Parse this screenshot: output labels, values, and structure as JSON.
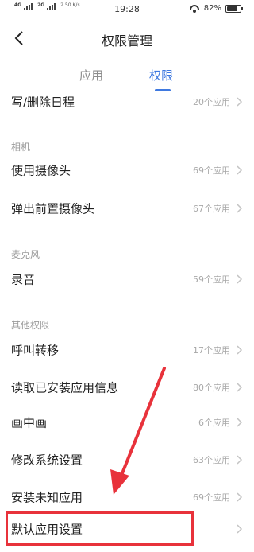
{
  "status_bar": {
    "network_1": "4G",
    "network_2": "2G",
    "speed": "2.50 K/s",
    "time": "19:28",
    "battery": "82%",
    "battery_level": 0.82
  },
  "header": {
    "title": "权限管理"
  },
  "tabs": [
    {
      "label": "应用",
      "active": false
    },
    {
      "label": "权限",
      "active": true
    }
  ],
  "rows": [
    {
      "label": "写/删除日程",
      "count": "20个应用"
    },
    {
      "label": "使用摄像头",
      "count": "69个应用"
    },
    {
      "label": "弹出前置摄像头",
      "count": "67个应用"
    },
    {
      "label": "录音",
      "count": "59个应用"
    },
    {
      "label": "呼叫转移",
      "count": "17个应用"
    },
    {
      "label": "读取已安装应用信息",
      "count": "80个应用"
    },
    {
      "label": "画中画",
      "count": "6个应用"
    },
    {
      "label": "修改系统设置",
      "count": "63个应用"
    },
    {
      "label": "安装未知应用",
      "count": "69个应用"
    },
    {
      "label": "默认应用设置",
      "count": ""
    }
  ],
  "sections": {
    "camera": "相机",
    "microphone": "麦克风",
    "other": "其他权限"
  },
  "colors": {
    "accent": "#3f79e0",
    "highlight": "#e8323b"
  }
}
